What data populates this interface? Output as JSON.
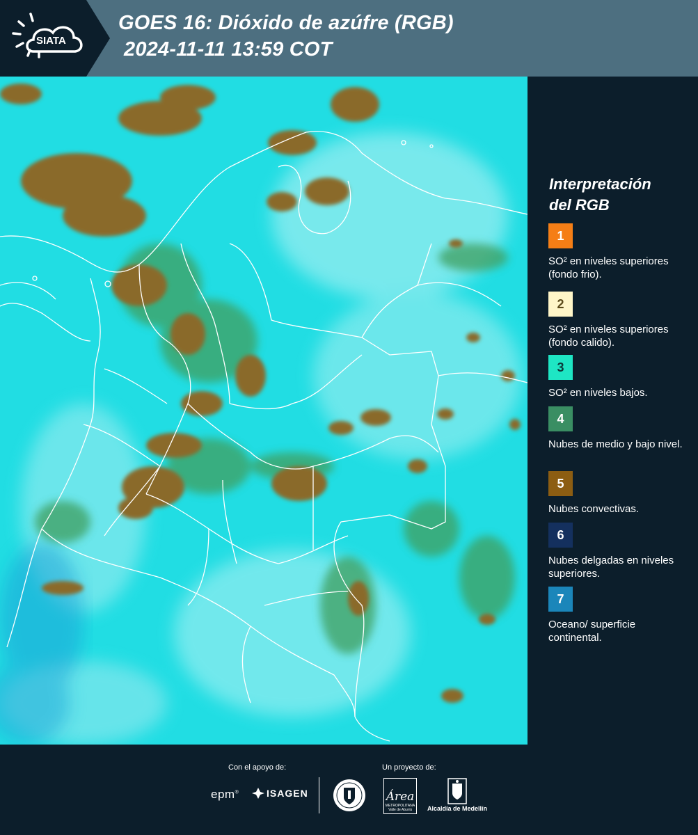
{
  "header": {
    "logo_text": "SIATA",
    "title_line1": "GOES 16: Dióxido de azúfre (RGB)",
    "title_line2": "2024-11-11 13:59 COT"
  },
  "map": {
    "background_color": "#21dde3",
    "cloud_color": "#8a6a2a",
    "border_color": "#ffffff"
  },
  "legend": {
    "title_line1": "Interpretación",
    "title_line2": "del RGB",
    "items": [
      {
        "number": "1",
        "color": "#f57e16",
        "number_color": "#ffffff",
        "text": "SO² en niveles superiores (fondo frio)."
      },
      {
        "number": "2",
        "color": "#fff6c8",
        "number_color": "#5b4a1a",
        "text": "SO² en niveles superiores (fondo calido)."
      },
      {
        "number": "3",
        "color": "#1ee6c4",
        "number_color": "#0c3a3a",
        "text": "SO² en niveles bajos."
      },
      {
        "number": "4",
        "color": "#3a8e63",
        "number_color": "#ffffff",
        "text": "Nubes de medio y bajo nivel."
      },
      {
        "number": "5",
        "color": "#8c5d12",
        "number_color": "#ffffff",
        "text": "Nubes convectivas."
      },
      {
        "number": "6",
        "color": "#14305e",
        "number_color": "#ffffff",
        "text": "Nubes delgadas en niveles superiores."
      },
      {
        "number": "7",
        "color": "#1b86ba",
        "number_color": "#ffffff",
        "text": "Oceano/ superficie continental."
      }
    ]
  },
  "footer": {
    "support_label": "Con el apoyo de:",
    "project_label": "Un proyecto de:",
    "epm": "epm",
    "isagen": "ISAGEN",
    "area_word": "Área",
    "area_sub": "METROPOLITANA Valle de Aburrá",
    "alcaldia": "Alcaldía de Medellín"
  }
}
